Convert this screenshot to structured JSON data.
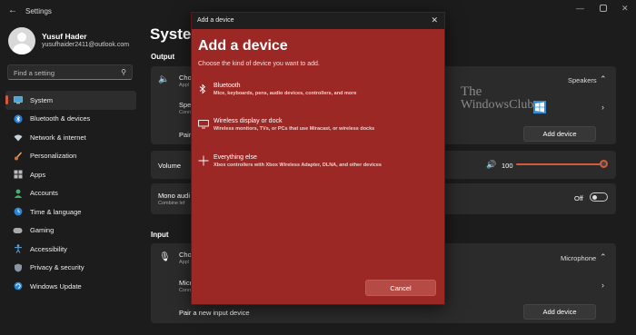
{
  "window": {
    "title": "Settings"
  },
  "profile": {
    "name": "Yusuf Hader",
    "email": "yusufhaider2411@outlook.com"
  },
  "search": {
    "placeholder": "Find a setting"
  },
  "nav": [
    {
      "label": "System",
      "icon": "monitor-icon",
      "active": true
    },
    {
      "label": "Bluetooth & devices",
      "icon": "bluetooth-icon"
    },
    {
      "label": "Network & internet",
      "icon": "wifi-icon"
    },
    {
      "label": "Personalization",
      "icon": "brush-icon"
    },
    {
      "label": "Apps",
      "icon": "apps-icon"
    },
    {
      "label": "Accounts",
      "icon": "person-icon"
    },
    {
      "label": "Time & language",
      "icon": "clock-globe-icon"
    },
    {
      "label": "Gaming",
      "icon": "gamepad-icon"
    },
    {
      "label": "Accessibility",
      "icon": "accessibility-icon"
    },
    {
      "label": "Privacy & security",
      "icon": "shield-icon"
    },
    {
      "label": "Windows Update",
      "icon": "update-icon"
    }
  ],
  "main": {
    "title": "System",
    "output": {
      "section": "Output",
      "choose_label": "Cho",
      "choose_sub": "Appl",
      "device_value": "Speakers",
      "speaker_label": "Spea",
      "speaker_sub": "Conn",
      "pair_label": "Pair",
      "add_device": "Add device",
      "volume_label": "Volume",
      "volume_value": "100",
      "mono_label": "Mono audi",
      "mono_sub": "Combine lef",
      "mono_state": "Off"
    },
    "input": {
      "section": "Input",
      "choose_label": "Cho",
      "choose_sub": "Appl",
      "device_value": "Microphone",
      "mic_label": "Micr",
      "mic_sub": "Conn",
      "pair_label": "Pair a new input device",
      "add_device": "Add device"
    }
  },
  "watermark": {
    "line1": "The",
    "line2": "WindowsClub"
  },
  "dialog": {
    "titlebar": "Add a device",
    "heading": "Add a device",
    "subtitle": "Choose the kind of device you want to add.",
    "options": [
      {
        "title": "Bluetooth",
        "desc": "Mice, keyboards, pens, audio devices, controllers, and more",
        "icon": "bluetooth-icon"
      },
      {
        "title": "Wireless display or dock",
        "desc": "Wireless monitors, TVs, or PCs that use Miracast, or wireless docks",
        "icon": "monitor-icon"
      },
      {
        "title": "Everything else",
        "desc": "Xbox controllers with Xbox Wireless Adapter, DLNA, and other devices",
        "icon": "plus-icon"
      }
    ],
    "cancel": "Cancel"
  },
  "colors": {
    "accent": "#d35a3c",
    "dialog_bg": "#9c2825",
    "app_bg": "#1c1c1c",
    "card_bg": "#2b2b2b"
  }
}
